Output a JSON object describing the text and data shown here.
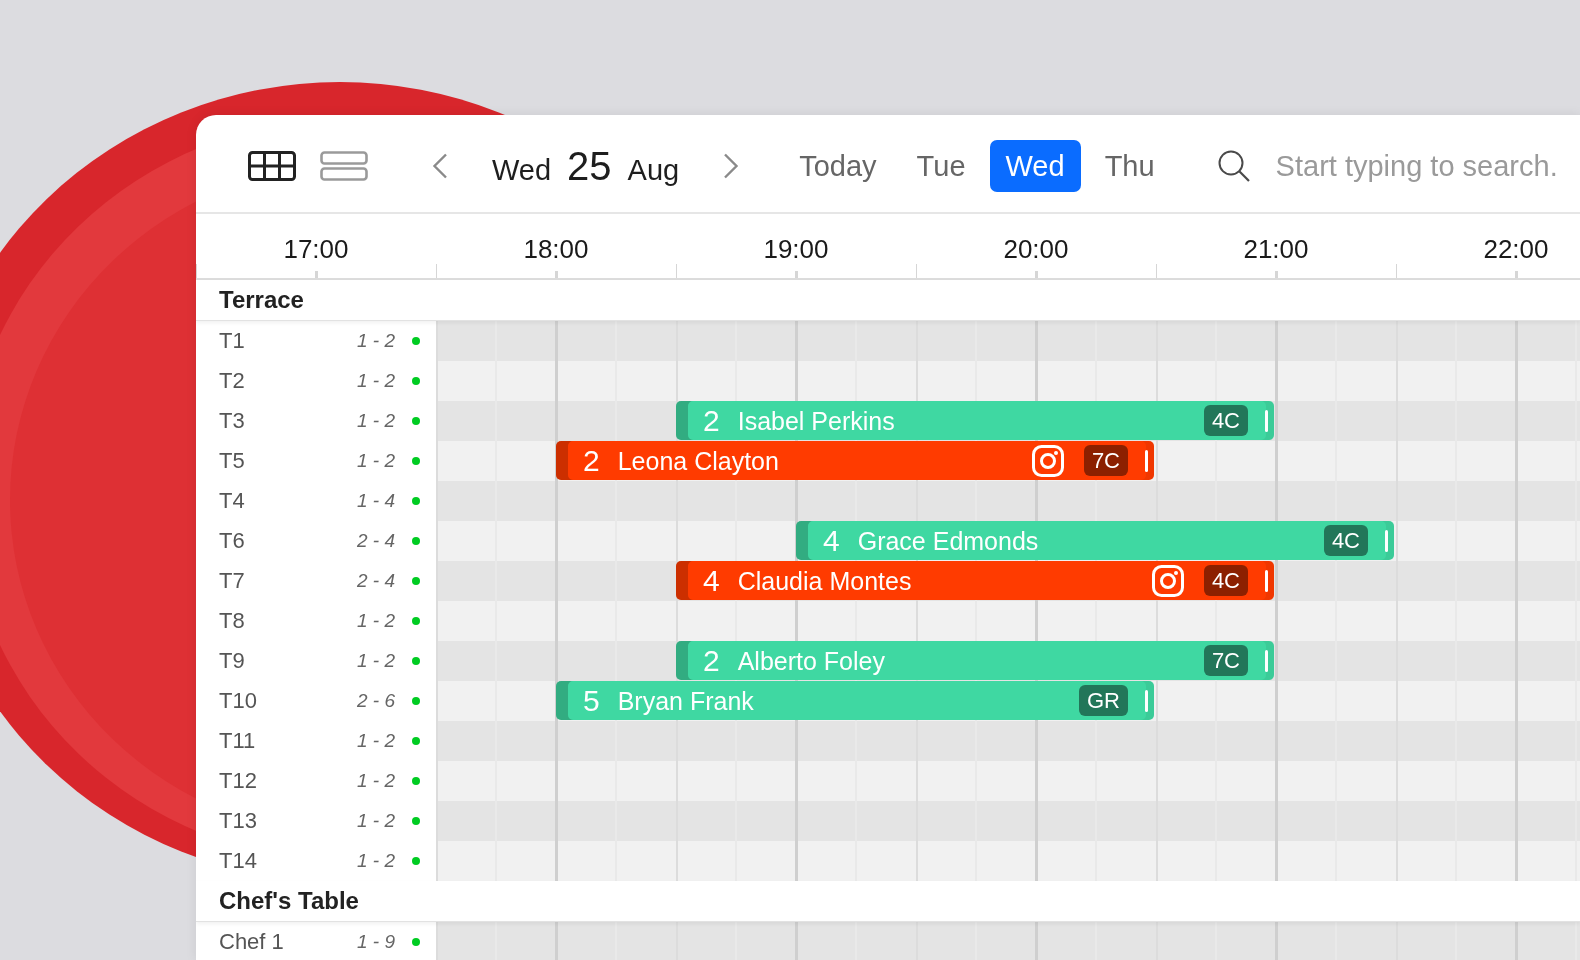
{
  "toolbar": {
    "views": [
      {
        "kind": "grid",
        "selected": true
      },
      {
        "kind": "list",
        "selected": false
      }
    ],
    "date": {
      "weekday": "Wed",
      "day": "25",
      "month": "Aug"
    },
    "days": [
      {
        "label": "Today",
        "selected": false
      },
      {
        "label": "Tue",
        "selected": false
      },
      {
        "label": "Wed",
        "selected": true
      },
      {
        "label": "Thu",
        "selected": false
      }
    ],
    "search": {
      "placeholder": "Start typing to search."
    }
  },
  "timeline": {
    "hours": [
      "17:00",
      "18:00",
      "19:00",
      "20:00",
      "21:00",
      "22:00"
    ]
  },
  "sections": [
    {
      "name": "Terrace",
      "tables": [
        {
          "name": "T1",
          "covers": "1 - 2",
          "color": "#00cc22"
        },
        {
          "name": "T2",
          "covers": "1 - 2",
          "color": "#00cc22"
        },
        {
          "name": "T3",
          "covers": "1 - 2",
          "color": "#00cc22",
          "bookings": [
            {
              "party": "2",
              "guest": "Isabel Perkins",
              "color": "#3fd8a2",
              "source_icon": false,
              "tag": "4C"
            }
          ]
        },
        {
          "name": "T5",
          "covers": "1 - 2",
          "color": "#00cc22",
          "bookings": [
            {
              "party": "2",
              "guest": "Leona Clayton",
              "color": "#ff3b00",
              "source_icon": true,
              "tag": "7C"
            }
          ]
        },
        {
          "name": "T4",
          "covers": "1 - 4",
          "color": "#00cc22"
        },
        {
          "name": "T6",
          "covers": "2 - 4",
          "color": "#00cc22",
          "bookings": [
            {
              "party": "4",
              "guest": "Grace Edmonds",
              "color": "#3fd8a2",
              "source_icon": false,
              "tag": "4C"
            }
          ]
        },
        {
          "name": "T7",
          "covers": "2 - 4",
          "color": "#00cc22",
          "bookings": [
            {
              "party": "4",
              "guest": "Claudia Montes",
              "color": "#ff3b00",
              "source_icon": true,
              "tag": "4C"
            }
          ]
        },
        {
          "name": "T8",
          "covers": "1 - 2",
          "color": "#00cc22"
        },
        {
          "name": "T9",
          "covers": "1 - 2",
          "color": "#00cc22",
          "bookings": [
            {
              "party": "2",
              "guest": "Alberto Foley",
              "color": "#3fd8a2",
              "source_icon": false,
              "tag": "7C"
            }
          ]
        },
        {
          "name": "T10",
          "covers": "2 - 6",
          "color": "#00cc22",
          "bookings": [
            {
              "party": "5",
              "guest": "Bryan Frank",
              "color": "#3fd8a2",
              "source_icon": false,
              "tag": "GR"
            }
          ]
        },
        {
          "name": "T11",
          "covers": "1 - 2",
          "color": "#00cc22"
        },
        {
          "name": "T12",
          "covers": "1 - 2",
          "color": "#00cc22"
        },
        {
          "name": "T13",
          "covers": "1 - 2",
          "color": "#00cc22"
        },
        {
          "name": "T14",
          "covers": "1 - 2",
          "color": "#00cc22"
        }
      ]
    },
    {
      "name": "Chef's Table",
      "tables": [
        {
          "name": "Chef 1",
          "covers": "1 - 9",
          "color": "#00cc22"
        }
      ]
    }
  ]
}
